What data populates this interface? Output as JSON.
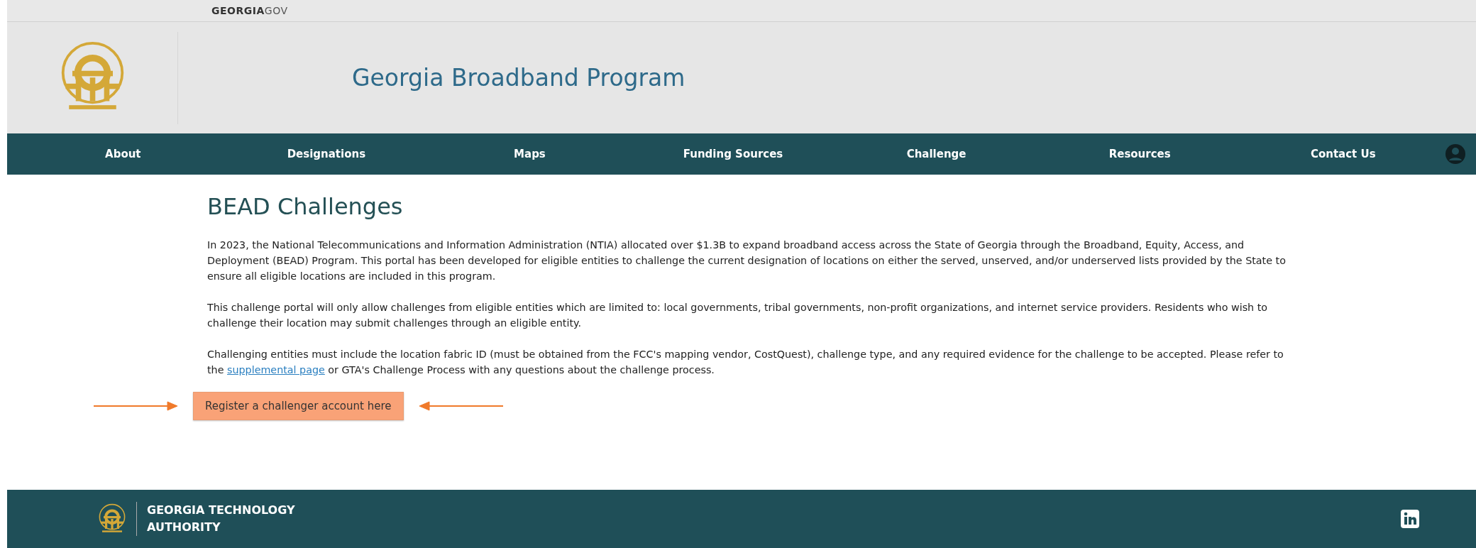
{
  "top_bar": {
    "brand": "**GEORGIA**GOV"
  },
  "header": {
    "title": "Georgia Broadband Program"
  },
  "nav": {
    "items": [
      "About",
      "Designations",
      "Maps",
      "Funding Sources",
      "Challenge",
      "Resources",
      "Contact Us"
    ]
  },
  "main": {
    "heading": "BEAD Challenges",
    "paragraphs": [
      {
        "text": "In 2023, the National Telecommunications and Information Administration (NTIA) allocated over $1.3B to expand broadband access across the State of Georgia through the Broadband, Equity, Access, and Deployment (BEAD) Program. This portal has been developed for eligible entities to challenge the current designation of locations on either the served, unserved, and/or underserved lists provided by the State to ensure all eligible locations are included in this program."
      },
      {
        "text": "This challenge portal will only allow challenges from eligible entities which are limited to: local governments, tribal governments, non-profit organizations, and internet service providers. Residents who wish to challenge their location may submit challenges through an eligible entity."
      },
      {
        "text": "Challenging entities must include the location fabric ID (must be obtained from the FCC's mapping vendor, CostQuest), challenge type, and any required evidence for the challenge to be accepted. Please refer to the ",
        "link": "supplemental page",
        "after": " or GTA's Challenge Process with any questions about the challenge process."
      }
    ],
    "register_button": "Register a challenger account here"
  },
  "footer": {
    "org_line_1": "GEORGIA TECHNOLOGY",
    "org_line_2": "AUTHORITY"
  }
}
